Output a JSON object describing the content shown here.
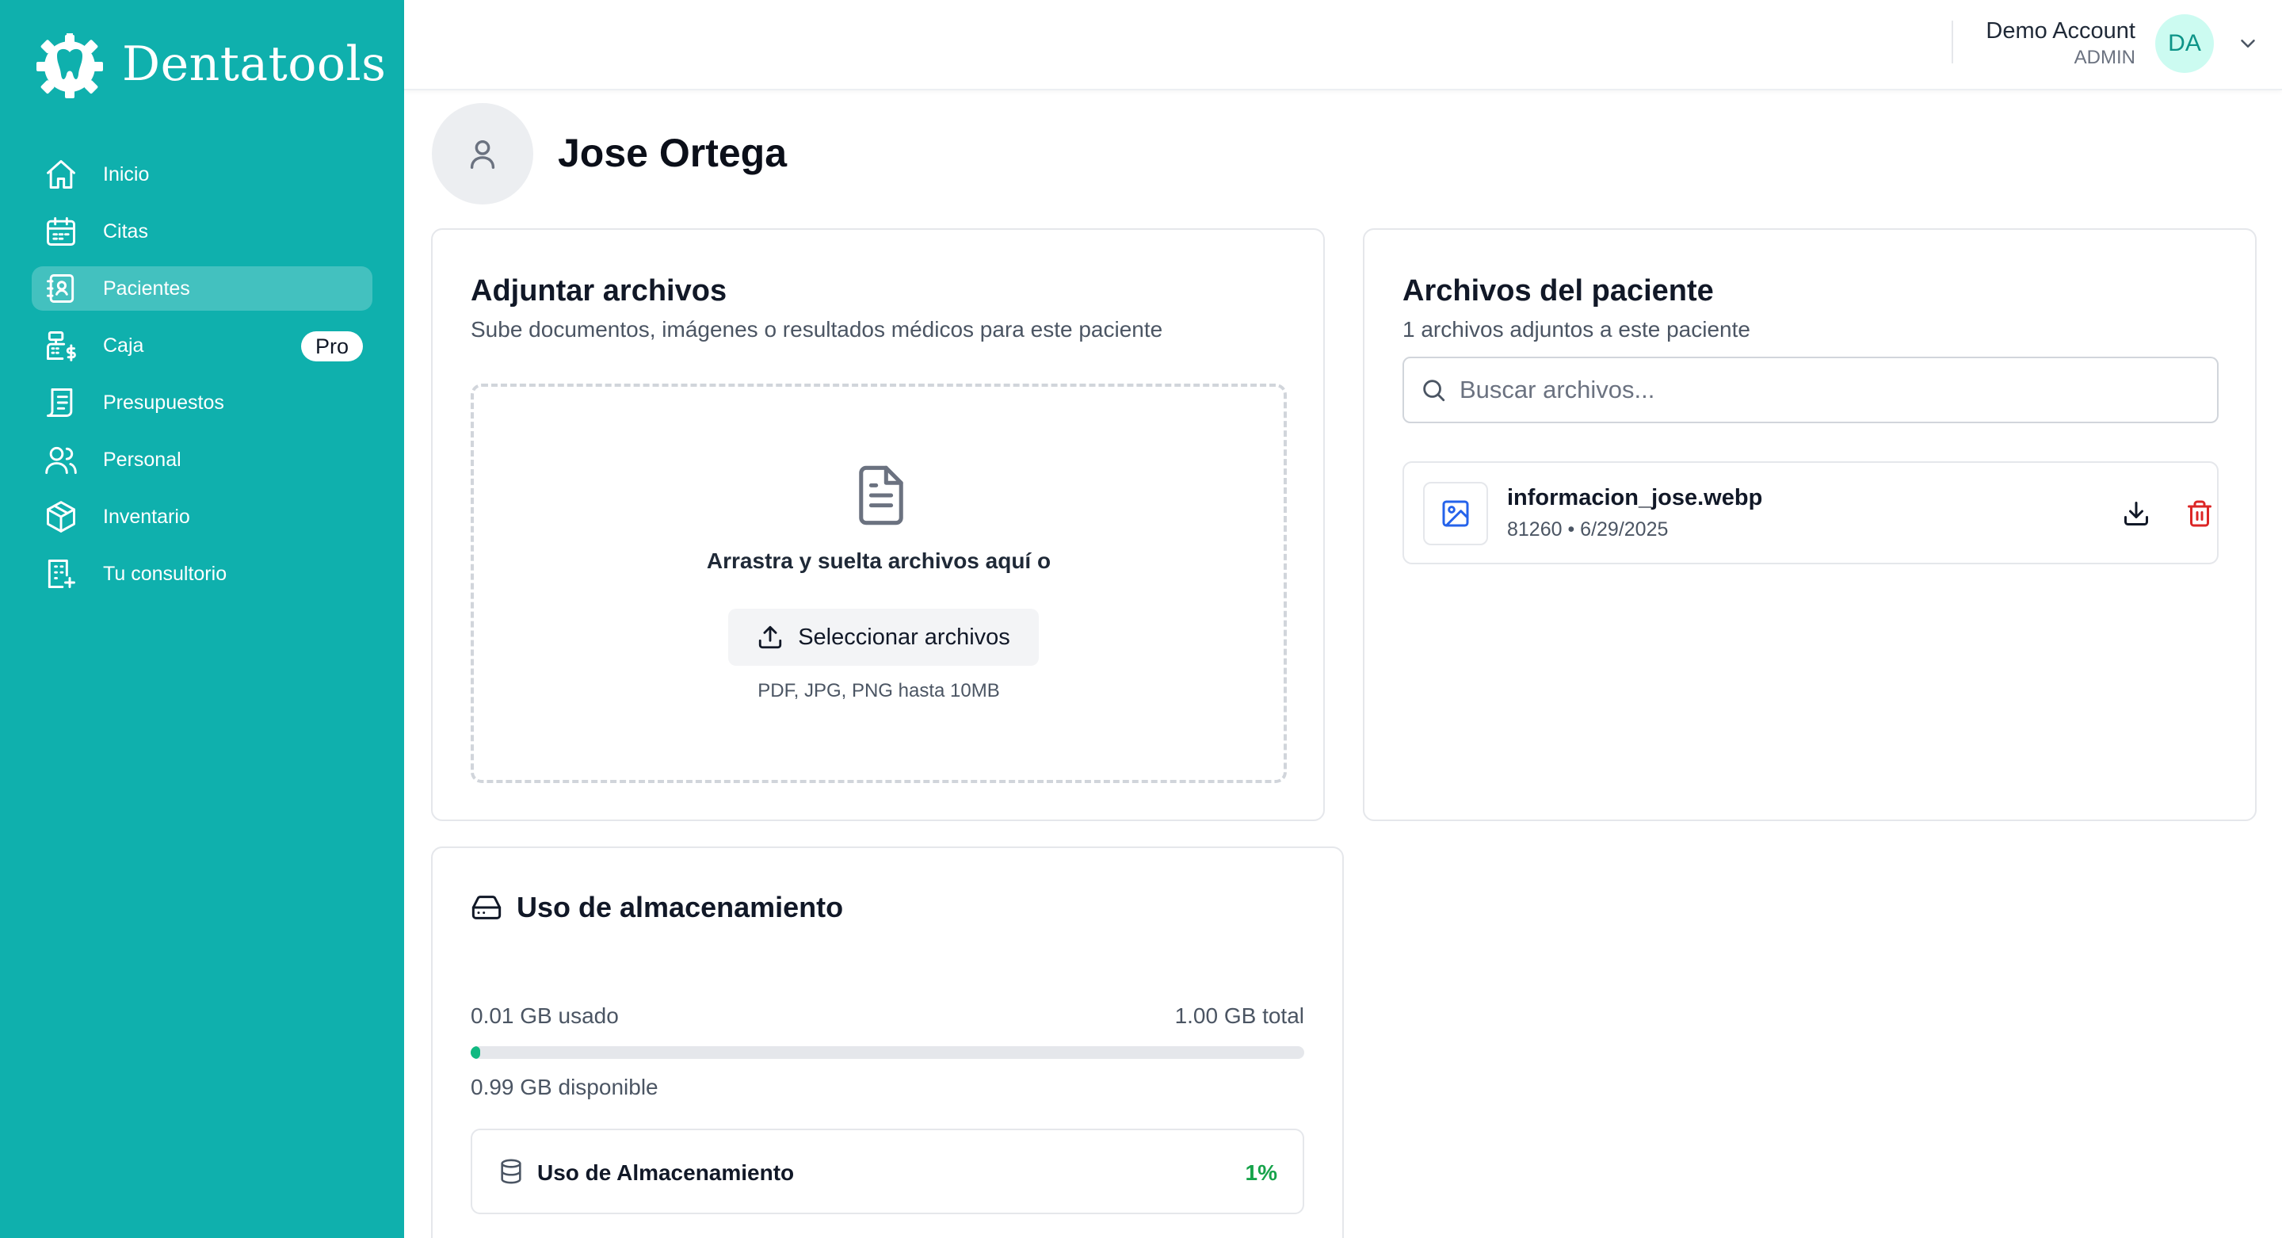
{
  "app": {
    "name": "Dentatools",
    "brand_color": "#0fb0ad"
  },
  "sidebar": {
    "items": [
      {
        "label": "Inicio",
        "icon": "home-icon",
        "active": false
      },
      {
        "label": "Citas",
        "icon": "calendar-icon",
        "active": false
      },
      {
        "label": "Pacientes",
        "icon": "patients-icon",
        "active": true
      },
      {
        "label": "Caja",
        "icon": "cash-register-icon",
        "active": false,
        "badge": "Pro"
      },
      {
        "label": "Presupuestos",
        "icon": "receipt-icon",
        "active": false
      },
      {
        "label": "Personal",
        "icon": "users-icon",
        "active": false
      },
      {
        "label": "Inventario",
        "icon": "box-icon",
        "active": false
      },
      {
        "label": "Tu consultorio",
        "icon": "building-icon",
        "active": false
      }
    ]
  },
  "header": {
    "account_name": "Demo Account",
    "account_role": "ADMIN",
    "avatar_initials": "DA"
  },
  "patient": {
    "name": "Jose Ortega"
  },
  "upload": {
    "title": "Adjuntar archivos",
    "subtitle": "Sube documentos, imágenes o resultados médicos para este paciente",
    "drop_text": "Arrastra y suelta archivos aquí o",
    "button_label": "Seleccionar archivos",
    "formats": "PDF, JPG, PNG hasta 10MB"
  },
  "files": {
    "title": "Archivos del paciente",
    "subtitle": "1 archivos adjuntos a este paciente",
    "search_placeholder": "Buscar archivos...",
    "items": [
      {
        "name": "informacion_jose.webp",
        "meta": "81260 • 6/29/2025",
        "icon": "image-icon"
      }
    ]
  },
  "storage": {
    "title": "Uso de almacenamiento",
    "used": "0.01 GB usado",
    "total": "1.00 GB total",
    "available": "0.99 GB disponible",
    "usage_fraction": 0.01,
    "row_label": "Uso de Almacenamiento",
    "row_percent": "1%",
    "accent_color": "#16a34a"
  }
}
